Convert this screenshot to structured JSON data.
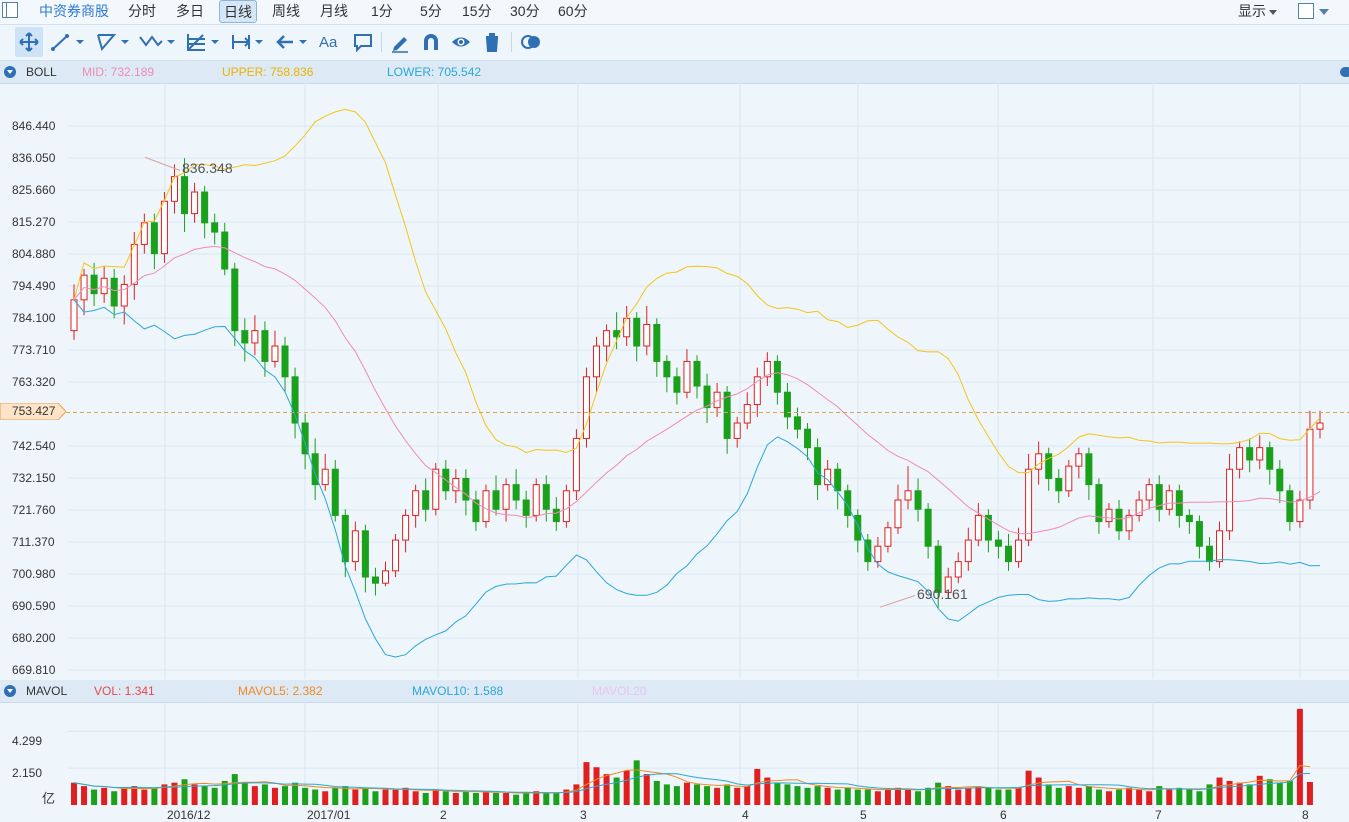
{
  "topbar": {
    "stock_name": "中资券商股",
    "tabs": [
      "分时",
      "多日",
      "日线",
      "周线",
      "月线",
      "1分",
      "5分",
      "15分",
      "30分",
      "60分"
    ],
    "active_tab": "日线",
    "display_label": "显示"
  },
  "toolbar": {
    "icons": [
      "move-icon",
      "line-tool-icon",
      "polyline-tool-icon",
      "wave-tool-icon",
      "fib-tool-icon",
      "range-tool-icon",
      "arrow-tool-icon",
      "text-tool-icon",
      "comment-tool-icon",
      "pen-icon",
      "magnet-icon",
      "eye-icon",
      "trash-icon",
      "compare-icon"
    ],
    "text_label": "Aa"
  },
  "boll": {
    "name": "BOLL",
    "mid": "MID: 732.189",
    "upper": "UPPER: 758.836",
    "lower": "LOWER: 705.542",
    "colors": {
      "mid": "#f08cb4",
      "upper": "#f5c518",
      "lower": "#2aa8d6"
    }
  },
  "price_axis": [
    "846.440",
    "836.050",
    "825.660",
    "815.270",
    "804.880",
    "794.490",
    "784.100",
    "773.710",
    "763.320",
    "753.427",
    "742.540",
    "732.150",
    "721.760",
    "711.370",
    "700.980",
    "690.590",
    "680.200",
    "669.810"
  ],
  "current_price": "753.427",
  "annotations": {
    "high": "836.348",
    "low": "690.161"
  },
  "mavol": {
    "name": "MAVOL",
    "vol": "VOL: 1.341",
    "mavol5": "MAVOL5: 2.382",
    "mavol10": "MAVOL10: 1.588",
    "mavol20": "MAVOL20",
    "axis": [
      "4.299",
      "2.150"
    ],
    "unit": "亿",
    "colors": {
      "vol": "#e84a4a",
      "mavol5": "#f08a24",
      "mavol10": "#2aa8d6",
      "mavol20": "#e8c6f0"
    }
  },
  "x_axis": [
    "2016/12",
    "2017/01",
    "2",
    "3",
    "4",
    "5",
    "6",
    "7",
    "8"
  ],
  "colors": {
    "up": "#e02020",
    "down": "#1aa01a",
    "grid": "#d8e6f2",
    "bg": "#eef5fb"
  },
  "chart_data": {
    "type": "candlestick",
    "y_range": [
      669.81,
      851.0
    ],
    "volume_range": [
      0,
      6.0
    ],
    "candles": [
      [
        780,
        790,
        777,
        795
      ],
      [
        790,
        798,
        785,
        800
      ],
      [
        798,
        792,
        788,
        802
      ],
      [
        792,
        797,
        789,
        801
      ],
      [
        797,
        788,
        784,
        800
      ],
      [
        788,
        795,
        782,
        798
      ],
      [
        795,
        808,
        790,
        812
      ],
      [
        808,
        815,
        805,
        818
      ],
      [
        815,
        805,
        800,
        818
      ],
      [
        805,
        822,
        802,
        825
      ],
      [
        822,
        830,
        818,
        834
      ],
      [
        830,
        818,
        812,
        836
      ],
      [
        818,
        825,
        815,
        828
      ],
      [
        825,
        815,
        810,
        827
      ],
      [
        815,
        812,
        808,
        818
      ],
      [
        812,
        800,
        798,
        815
      ],
      [
        800,
        780,
        775,
        802
      ],
      [
        780,
        776,
        770,
        784
      ],
      [
        776,
        780,
        772,
        785
      ],
      [
        780,
        770,
        765,
        783
      ],
      [
        770,
        775,
        768,
        780
      ],
      [
        775,
        765,
        760,
        778
      ],
      [
        765,
        750,
        745,
        768
      ],
      [
        750,
        740,
        735,
        753
      ],
      [
        740,
        730,
        725,
        745
      ],
      [
        730,
        735,
        728,
        740
      ],
      [
        735,
        720,
        718,
        738
      ],
      [
        720,
        705,
        700,
        722
      ],
      [
        705,
        715,
        702,
        718
      ],
      [
        715,
        700,
        695,
        717
      ],
      [
        700,
        698,
        694,
        703
      ],
      [
        698,
        702,
        697,
        705
      ],
      [
        702,
        712,
        700,
        714
      ],
      [
        712,
        720,
        708,
        722
      ],
      [
        720,
        728,
        716,
        730
      ],
      [
        728,
        722,
        718,
        732
      ],
      [
        722,
        735,
        720,
        737
      ],
      [
        735,
        728,
        725,
        738
      ],
      [
        728,
        732,
        724,
        735
      ],
      [
        732,
        725,
        720,
        735
      ],
      [
        725,
        718,
        715,
        728
      ],
      [
        718,
        728,
        716,
        730
      ],
      [
        728,
        722,
        720,
        733
      ],
      [
        722,
        730,
        718,
        732
      ],
      [
        730,
        725,
        722,
        735
      ],
      [
        725,
        720,
        716,
        728
      ],
      [
        720,
        730,
        718,
        732
      ],
      [
        730,
        722,
        718,
        733
      ],
      [
        722,
        718,
        715,
        726
      ],
      [
        718,
        728,
        716,
        730
      ],
      [
        728,
        745,
        725,
        748
      ],
      [
        745,
        765,
        742,
        768
      ],
      [
        765,
        775,
        760,
        778
      ],
      [
        775,
        780,
        770,
        782
      ],
      [
        780,
        778,
        774,
        786
      ],
      [
        778,
        784,
        775,
        788
      ],
      [
        784,
        775,
        770,
        786
      ],
      [
        775,
        782,
        772,
        788
      ],
      [
        782,
        770,
        765,
        784
      ],
      [
        770,
        765,
        760,
        772
      ],
      [
        765,
        760,
        756,
        768
      ],
      [
        760,
        770,
        758,
        774
      ],
      [
        770,
        762,
        758,
        772
      ],
      [
        762,
        755,
        750,
        766
      ],
      [
        755,
        760,
        752,
        763
      ],
      [
        760,
        745,
        740,
        762
      ],
      [
        745,
        750,
        742,
        752
      ],
      [
        750,
        756,
        748,
        760
      ],
      [
        756,
        765,
        752,
        768
      ],
      [
        765,
        770,
        762,
        773
      ],
      [
        770,
        760,
        756,
        772
      ],
      [
        760,
        752,
        748,
        763
      ],
      [
        752,
        748,
        745,
        755
      ],
      [
        748,
        742,
        738,
        750
      ],
      [
        742,
        730,
        725,
        745
      ],
      [
        730,
        735,
        728,
        738
      ],
      [
        735,
        728,
        722,
        737
      ],
      [
        728,
        720,
        716,
        730
      ],
      [
        720,
        712,
        708,
        722
      ],
      [
        712,
        705,
        702,
        714
      ],
      [
        705,
        710,
        703,
        713
      ],
      [
        710,
        716,
        708,
        718
      ],
      [
        716,
        725,
        714,
        730
      ],
      [
        725,
        728,
        722,
        736
      ],
      [
        728,
        722,
        718,
        732
      ],
      [
        722,
        710,
        706,
        724
      ],
      [
        710,
        695,
        690,
        712
      ],
      [
        695,
        700,
        693,
        703
      ],
      [
        700,
        705,
        698,
        708
      ],
      [
        705,
        712,
        702,
        716
      ],
      [
        712,
        720,
        710,
        724
      ],
      [
        720,
        712,
        708,
        722
      ],
      [
        712,
        710,
        706,
        715
      ],
      [
        710,
        705,
        702,
        714
      ],
      [
        705,
        712,
        703,
        716
      ],
      [
        712,
        735,
        710,
        740
      ],
      [
        735,
        740,
        730,
        744
      ],
      [
        740,
        732,
        728,
        742
      ],
      [
        732,
        728,
        724,
        735
      ],
      [
        728,
        736,
        726,
        738
      ],
      [
        736,
        740,
        732,
        742
      ],
      [
        740,
        730,
        725,
        742
      ],
      [
        730,
        718,
        714,
        732
      ],
      [
        718,
        722,
        716,
        724
      ],
      [
        722,
        715,
        712,
        725
      ],
      [
        715,
        720,
        712,
        722
      ],
      [
        720,
        725,
        718,
        728
      ],
      [
        725,
        730,
        722,
        732
      ],
      [
        730,
        722,
        718,
        733
      ],
      [
        722,
        728,
        720,
        730
      ],
      [
        728,
        720,
        716,
        730
      ],
      [
        720,
        718,
        714,
        722
      ],
      [
        718,
        710,
        706,
        720
      ],
      [
        710,
        705,
        702,
        713
      ],
      [
        705,
        715,
        703,
        718
      ],
      [
        715,
        735,
        712,
        740
      ],
      [
        735,
        742,
        732,
        744
      ],
      [
        742,
        738,
        734,
        745
      ],
      [
        738,
        742,
        735,
        746
      ],
      [
        742,
        735,
        730,
        744
      ],
      [
        735,
        728,
        724,
        738
      ],
      [
        728,
        718,
        715,
        730
      ],
      [
        718,
        725,
        716,
        728
      ],
      [
        725,
        748,
        722,
        754
      ],
      [
        748,
        750,
        745,
        754
      ]
    ],
    "volumes": [
      1.3,
      1.1,
      0.9,
      1.0,
      0.8,
      1.0,
      1.1,
      0.9,
      1.0,
      1.2,
      1.3,
      1.5,
      1.2,
      1.1,
      1.0,
      1.4,
      1.8,
      1.3,
      1.1,
      1.2,
      1.0,
      1.1,
      1.3,
      1.0,
      0.9,
      0.8,
      1.0,
      1.1,
      0.9,
      1.0,
      0.8,
      0.9,
      0.9,
      1.0,
      0.8,
      0.7,
      0.9,
      0.8,
      0.7,
      0.8,
      0.7,
      0.8,
      0.7,
      0.7,
      0.6,
      0.7,
      0.8,
      0.7,
      0.7,
      0.9,
      1.2,
      2.5,
      2.2,
      1.8,
      1.6,
      2.0,
      2.6,
      1.8,
      1.4,
      1.2,
      1.1,
      1.3,
      1.2,
      1.1,
      1.0,
      1.2,
      1.0,
      1.1,
      2.1,
      1.6,
      1.3,
      1.2,
      1.1,
      1.0,
      1.1,
      1.0,
      0.9,
      1.0,
      0.9,
      0.9,
      0.8,
      0.9,
      1.0,
      0.9,
      0.8,
      1.0,
      1.3,
      1.1,
      0.9,
      1.0,
      1.1,
      1.0,
      0.9,
      0.9,
      1.0,
      2.0,
      1.6,
      1.2,
      1.0,
      1.1,
      1.0,
      1.1,
      0.9,
      0.8,
      0.9,
      1.0,
      0.9,
      0.8,
      1.1,
      0.9,
      1.0,
      0.9,
      0.8,
      1.2,
      1.6,
      1.4,
      1.3,
      1.2,
      1.7,
      1.5,
      1.3,
      1.4,
      5.6,
      1.341
    ],
    "x_ticks": [
      "2016/12",
      "2017/01",
      "2",
      "3",
      "4",
      "5",
      "6",
      "7",
      "8"
    ]
  }
}
